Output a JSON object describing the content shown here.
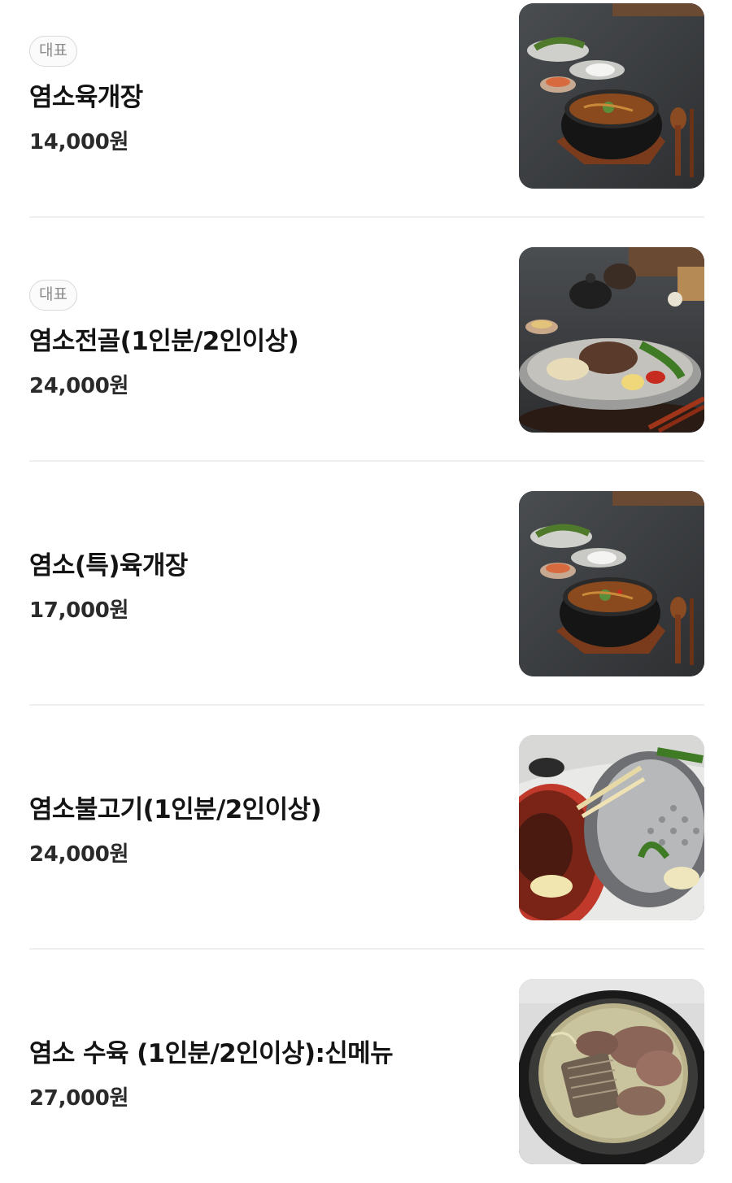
{
  "menu": {
    "items": [
      {
        "badge": "대표",
        "name": "염소육개장",
        "price": "14,000원",
        "image": "spicy-goat-soup-photo"
      },
      {
        "badge": "대표",
        "name": "염소전골(1인분/2인이상)",
        "price": "24,000원",
        "image": "goat-hotpot-photo"
      },
      {
        "badge": "",
        "name": "염소(특)육개장",
        "price": "17,000원",
        "image": "spicy-goat-soup-special-photo"
      },
      {
        "badge": "",
        "name": "염소불고기(1인분/2인이상)",
        "price": "24,000원",
        "image": "goat-bulgogi-grill-photo"
      },
      {
        "badge": "",
        "name": "염소 수육 (1인분/2인이상):신메뉴",
        "price": "27,000원",
        "image": "boiled-goat-meat-photo"
      }
    ]
  }
}
